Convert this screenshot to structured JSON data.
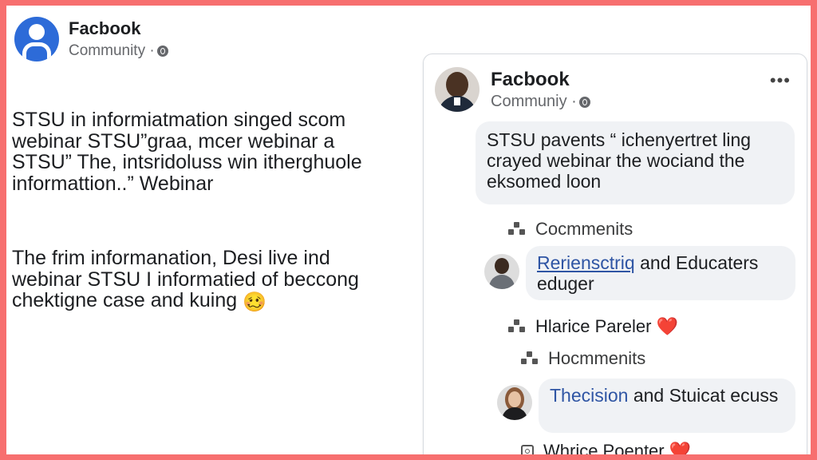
{
  "left_post": {
    "page_name": "Facbook",
    "page_sub": "Community ·",
    "paragraph_1": "STSU in informiatmation singed scom webinar STSU”graa, mcer webinar a STSU” The, intsridoluss win itherghuole informattion..” Webinar",
    "paragraph_2": "The frim informanation, Desi live ind webinar STSU I informatied of beccong chektigne case and kuing",
    "emoji": "🥴"
  },
  "card": {
    "page_name": "Facbook",
    "page_sub": "Communiy ·",
    "more": "•••",
    "post_text": "STSU pavents “ ichenyertret ling crayed webinar the wociand the eksomed loon",
    "comments_label": "Cocmmenits",
    "comment_1": {
      "name": "Reriensctriq",
      "text": " and Educaters eduger"
    },
    "reactor_1": "Hlarice Pareler",
    "reactor_1_emoji": "❤️",
    "comments_label_2": "Hocmmenits",
    "comment_2": {
      "name": "Thecision",
      "text": " and Stuicat ecuss"
    },
    "reactor_2": "Whrice Poenter",
    "reactor_2_emoji": "❤️"
  },
  "colors": {
    "background_border": "#f76f6f",
    "link": "#2f55a4",
    "bubble": "#f0f2f5",
    "page_avatar": "#2d6bd8",
    "heart": "#e0242c"
  },
  "icons": [
    "page-avatar-icon",
    "globe-icon",
    "more-options-icon",
    "comments-icon",
    "heart-icon",
    "refresh-icon"
  ]
}
